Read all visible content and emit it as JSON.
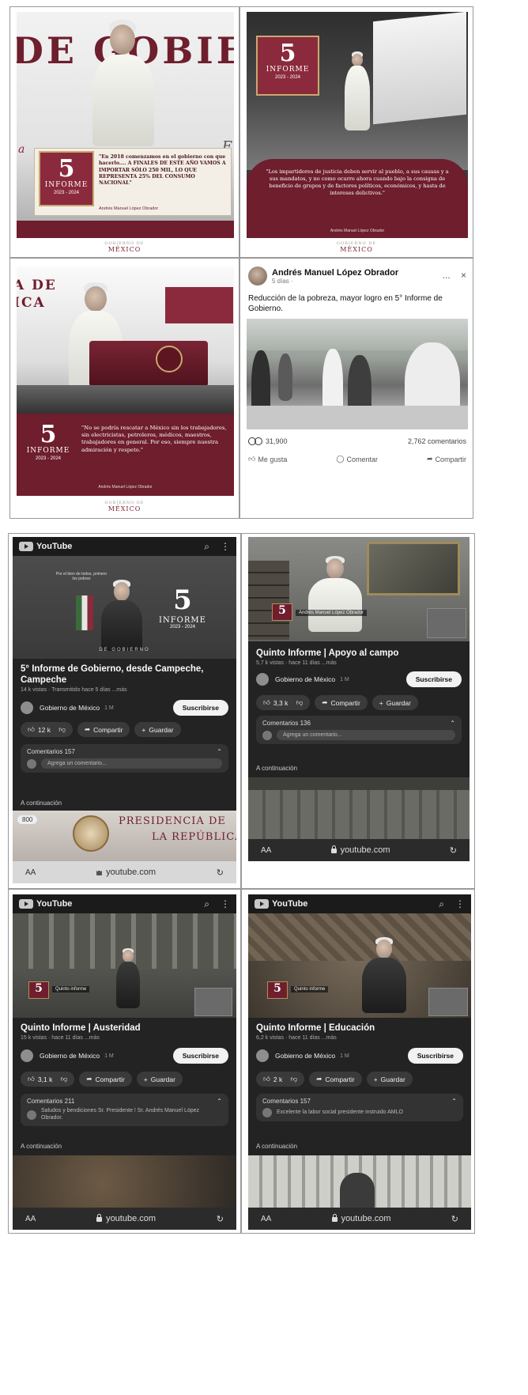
{
  "posters": {
    "p1": {
      "big_text": "DE GOBIE",
      "side_letter_left": "a",
      "side_letter_right": "E",
      "logo_number": "5",
      "logo_label": "INFORME",
      "logo_years": "2023 - 2024",
      "quote": "\"En 2018 comenzamos en el gobierno con que hacerlo.... A FINALES DE ESTE AÑO VAMOS A IMPORTAR SÓLO 250 MIL, LO QUE REPRESENTA 25% DEL CONSUMO NACIONAL\"",
      "signature": "Andrés Manuel López Obrador",
      "footer": "MÉXICO",
      "footer_small": "GOBIERNO DE"
    },
    "p2": {
      "logo_number": "5",
      "logo_label": "INFORME",
      "logo_years": "2023 - 2024",
      "quote": "\"Los impartidores de justicia deben servir al pueblo, a sus causas y a sus mandatos, y no como ocurre ahora cuando bajo la consigna de beneficio de grupos y de factores políticos, económicos, y hasta de intereses delictivos.\"",
      "signature": "Andrés Manuel López Obrador",
      "footer": "MÉXICO",
      "footer_small": "GOBIERNO DE"
    },
    "p3": {
      "big_text_1": "A DE",
      "big_text_2": "ICA",
      "logo_number": "5",
      "logo_label": "INFORME",
      "logo_years": "2023 - 2024",
      "quote": "\"No se podría rescatar a México sin los trabajadores, sin electricistas, petroleros, médicos, maestros, trabajadores en general. Por eso, siempre nuestra admiración y respeto.\"",
      "signature": "Andrés Manuel López Obrador",
      "footer": "MÉXICO",
      "footer_small": "GOBIERNO DE"
    }
  },
  "facebook": {
    "author": "Andrés Manuel López Obrador",
    "meta": "5 días ·",
    "close": "×",
    "more": "...",
    "text": "Reducción de la pobreza, mayor logro en 5° Informe de Gobierno.",
    "reactions_count": "31,900",
    "comments_count": "2,762 comentarios",
    "action_like": "Me gusta",
    "action_comment": "Comentar",
    "action_share": "Compartir"
  },
  "youtube": {
    "common": {
      "logo": "YouTube",
      "search_icon": "⌕",
      "more_icon": "⋮",
      "aa": "AA",
      "url": "youtube.com",
      "reload": "↻",
      "channel": "Gobierno de México",
      "subscribe": "Suscribirse",
      "share": "Compartir",
      "save": "Guardar",
      "next_label": "A continuación"
    },
    "v1": {
      "title": "5° Informe de Gobierno, desde Campeche, Campeche",
      "views": "14 k vistas · Transmitido hace 5 días ...más",
      "subs": "1 M",
      "likes": "12 k",
      "comments_label": "Comentarios 157",
      "comment_text": "Agrega un comentario...",
      "overlay_top": "Por el bien de todos, primero los pobres",
      "logo_number": "5",
      "logo_label": "INFORME",
      "logo_years": "2023 - 2024",
      "banner": "DE GOBIERNO",
      "next_thumb_text_1": "PRESIDENCIA DE",
      "next_thumb_text_2": "LA REPÚBLICA",
      "next_badge": "800"
    },
    "v2": {
      "title": "Quinto Informe | Apoyo al campo",
      "views": "5,7 k vistas · hace 11 días ...más",
      "subs": "1 M",
      "likes": "3,3 k",
      "comments_label": "Comentarios 136",
      "comment_text": "Agrega un comentario...",
      "caption": "Andrés Manuel López Obrador",
      "logo_number": "5"
    },
    "v3": {
      "title": "Quinto Informe | Austeridad",
      "views": "15 k vistas · hace 11 días ...más",
      "subs": "1 M",
      "likes": "3,1 k",
      "comments_label": "Comentarios 211",
      "comment_text": "Saludos y bendiciones Sr. Presidente ! Sr. Andrés Manuel López Obrador.",
      "caption": "Quinto informe",
      "logo_number": "5"
    },
    "v4": {
      "title": "Quinto Informe | Educación",
      "views": "6,2 k vistas · hace 11 días ...más",
      "subs": "1 M",
      "likes": "2 k",
      "comments_label": "Comentarios 157",
      "comment_text": "Excelente la labor social presidente instruido AMLO",
      "caption": "Quinto informe",
      "logo_number": "5"
    }
  },
  "colors": {
    "guinda": "#6e1e2d",
    "gold": "#b48e55",
    "yt_dark": "#232323"
  }
}
